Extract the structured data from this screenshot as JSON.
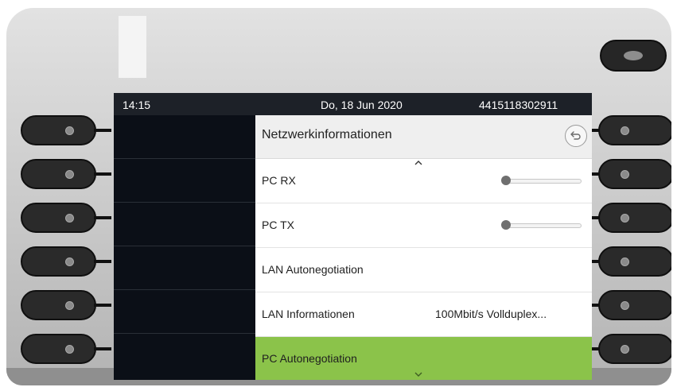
{
  "statusbar": {
    "time": "14:15",
    "date": "Do, 18 Jun 2020",
    "number": "4415118302911"
  },
  "header": {
    "title": "Netzwerkinformationen",
    "back_icon": "back-arrow-icon"
  },
  "rows": [
    {
      "label": "PC RX",
      "value": "",
      "control": "slider"
    },
    {
      "label": "PC TX",
      "value": "",
      "control": "slider"
    },
    {
      "label": "LAN Autonegotiation",
      "value": ""
    },
    {
      "label": "LAN Informationen",
      "value": "100Mbit/s Vollduplex..."
    },
    {
      "label": "PC Autonegotiation",
      "value": "",
      "selected": true
    }
  ],
  "colors": {
    "selected": "#8bc34a",
    "screen_dark": "#0b0f17"
  }
}
